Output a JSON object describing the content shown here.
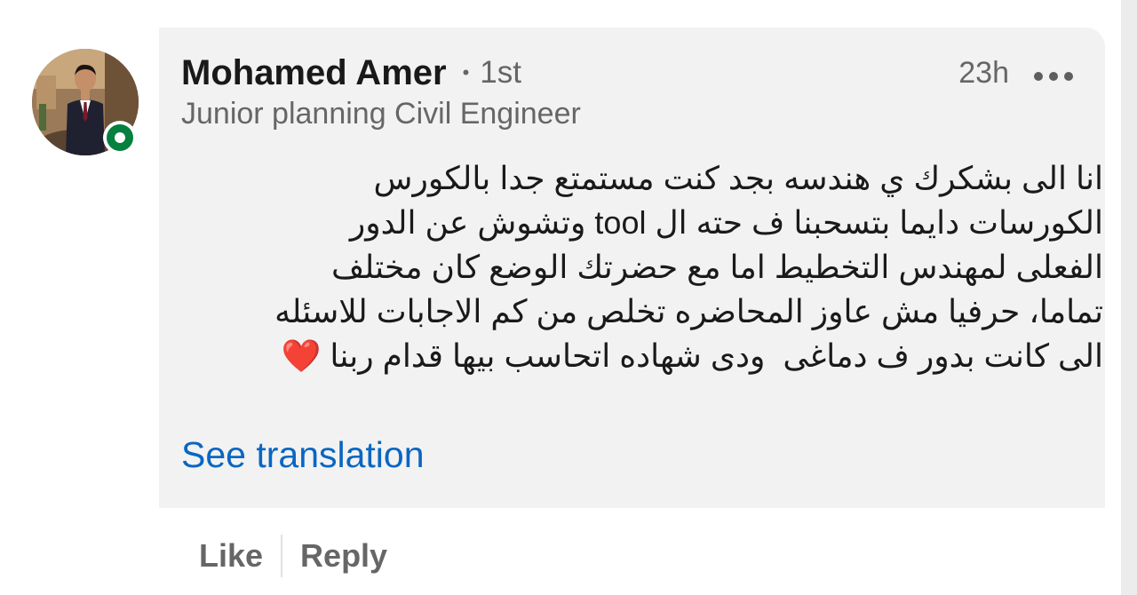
{
  "comment": {
    "author": {
      "name": "Mohamed Amer",
      "separator": "•",
      "connection_degree": "1st",
      "headline": "Junior planning Civil Engineer",
      "avatar_icon": "profile-photo",
      "status_icon": "online-presence-icon"
    },
    "timestamp": "23h",
    "more_icon": "more-options-icon",
    "text": "انا الى بشكرك ي هندسه بجد كنت مستمتع جدا بالكورس\nالكورسات دايما بتسحبنا ف حته ال tool وتشوش عن الدور\nالفعلى لمهندس التخطيط اما مع حضرتك الوضع كان مختلف\nتماما، حرفيا مش عاوز المحاضره تخلص من كم الاجابات للاسئله\nالى كانت بدور ف دماغى  ودى شهاده اتحاسب بيها قدام ربنا ❤️",
    "see_translation_label": "See translation"
  },
  "actions": {
    "like_label": "Like",
    "reply_label": "Reply"
  },
  "colors": {
    "bubble_background": "#f2f2f2",
    "primary_text": "#191919",
    "secondary_text": "#666666",
    "link": "#0a66c2",
    "presence": "#06803f"
  }
}
